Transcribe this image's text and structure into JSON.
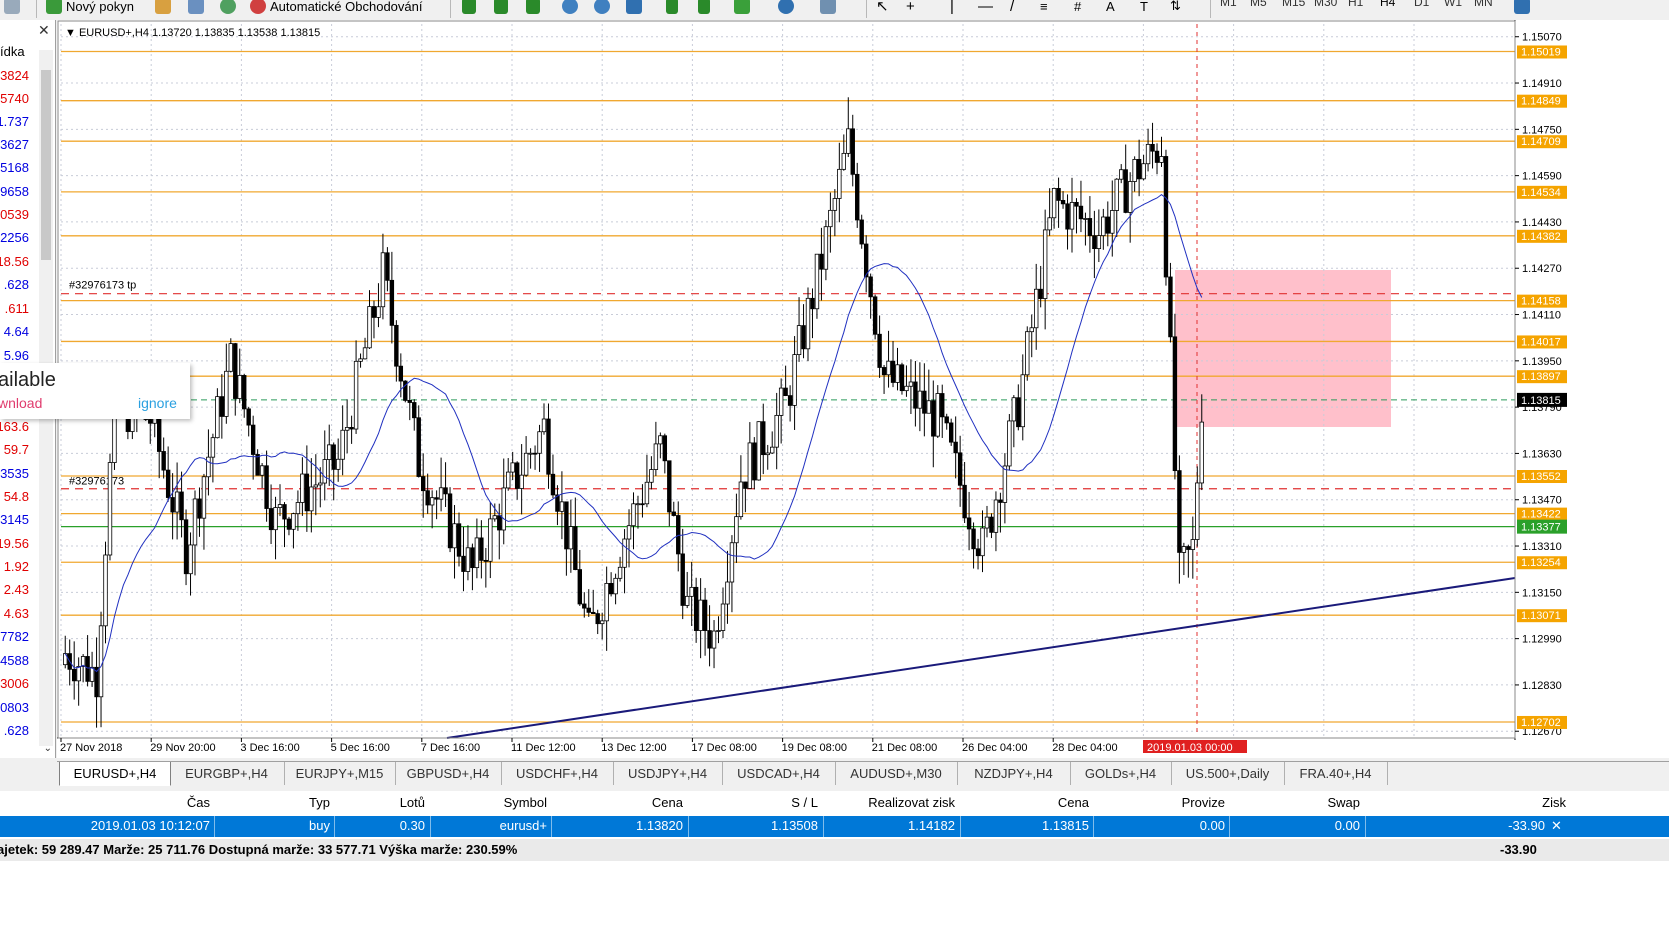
{
  "toolbar": {
    "new_order_label": "Nový pokyn",
    "algo_trading_label": "Automatické Obchodování",
    "timeframes": [
      "M1",
      "M5",
      "M15",
      "M30",
      "H1",
      "H4",
      "D1",
      "W1",
      "MN"
    ],
    "active_timeframe": "H4"
  },
  "left_panel": {
    "header": "ídka",
    "values": [
      {
        "text": "3824",
        "color": "red"
      },
      {
        "text": "5740",
        "color": "red"
      },
      {
        "text": "1.737",
        "color": "blue"
      },
      {
        "text": "3627",
        "color": "blue"
      },
      {
        "text": "5168",
        "color": "blue"
      },
      {
        "text": "9658",
        "color": "blue"
      },
      {
        "text": "0539",
        "color": "red"
      },
      {
        "text": "2256",
        "color": "blue"
      },
      {
        "text": "18.56",
        "color": "red"
      },
      {
        "text": ".628",
        "color": "blue"
      },
      {
        "text": ".611",
        "color": "red"
      },
      {
        "text": "4.64",
        "color": "blue"
      },
      {
        "text": "5.96",
        "color": "blue"
      },
      {
        "text": "163.6",
        "color": "red"
      },
      {
        "text": "59.7",
        "color": "red"
      },
      {
        "text": "3535",
        "color": "blue"
      },
      {
        "text": "54.8",
        "color": "red"
      },
      {
        "text": "3145",
        "color": "blue"
      },
      {
        "text": "19.56",
        "color": "red"
      },
      {
        "text": "1.92",
        "color": "red"
      },
      {
        "text": "2.43",
        "color": "red"
      },
      {
        "text": "4.63",
        "color": "red"
      },
      {
        "text": "7782",
        "color": "blue"
      },
      {
        "text": "4588",
        "color": "blue"
      },
      {
        "text": "3006",
        "color": "red"
      },
      {
        "text": "0803",
        "color": "blue"
      },
      {
        "text": ".628",
        "color": "blue"
      }
    ]
  },
  "notification": {
    "title": "ailable",
    "download": "wnload",
    "ignore": "ignore"
  },
  "chart": {
    "header": "EURUSD+,H4  1.13720 1.13835 1.13538 1.13815",
    "tp_label": "#32976173 tp",
    "sl_label": "#32976173",
    "current_price": "1.13815",
    "order_price": "1.13377",
    "time_marker": "2019.01.03 00:00",
    "price_ticks": [
      "1.15070",
      "1.14910",
      "1.14750",
      "1.14590",
      "1.14430",
      "1.14270",
      "1.14110",
      "1.13950",
      "1.13790",
      "1.13630",
      "1.13470",
      "1.13310",
      "1.13150",
      "1.12990",
      "1.12830",
      "1.12670"
    ],
    "level_tags": [
      "1.15019",
      "1.14849",
      "1.14709",
      "1.14534",
      "1.14382",
      "1.14158",
      "1.14017",
      "1.13897",
      "1.13552",
      "1.13422",
      "1.13254",
      "1.13071",
      "1.12702"
    ],
    "date_labels": [
      "27 Nov 2018",
      "29 Nov 20:00",
      "3 Dec 16:00",
      "5 Dec 16:00",
      "7 Dec 16:00",
      "11 Dec 12:00",
      "13 Dec 12:00",
      "17 Dec 08:00",
      "19 Dec 08:00",
      "21 Dec 08:00",
      "26 Dec 04:00",
      "28 Dec 04:00"
    ],
    "colors": {
      "level": "#f0a830",
      "tag": "#f5a400",
      "stop_line": "#e03030",
      "order_line": "#2aa02a",
      "ma": "#2030c0",
      "trend": "#1a1a7a",
      "zone": "#ffc0cb"
    }
  },
  "tabs": [
    "EURUSD+,H4",
    "EURGBP+,H4",
    "EURJPY+,M15",
    "GBPUSD+,H4",
    "USDCHF+,H4",
    "USDJPY+,H4",
    "USDCAD+,H4",
    "AUDUSD+,M30",
    "NZDJPY+,H4",
    "GOLDs+,H4",
    "US.500+,Daily",
    "FRA.40+,H4"
  ],
  "active_tab": "EURUSD+,H4",
  "terminal": {
    "columns": [
      "Čas",
      "Typ",
      "Lotů",
      "Symbol",
      "Cena",
      "S / L",
      "Realizovat zisk",
      "Cena",
      "Provize",
      "Swap",
      "Zisk"
    ],
    "row": [
      "2019.01.03 10:12:07",
      "buy",
      "0.30",
      "eurusd+",
      "1.13820",
      "1.13508",
      "1.14182",
      "1.13815",
      "0.00",
      "0.00",
      "-33.90"
    ],
    "summary": "ajetek: 59 289.47  Marže: 25 711.76  Dostupná marže: 33 577.71  Výška marže: 230.59%",
    "total": "-33.90"
  }
}
